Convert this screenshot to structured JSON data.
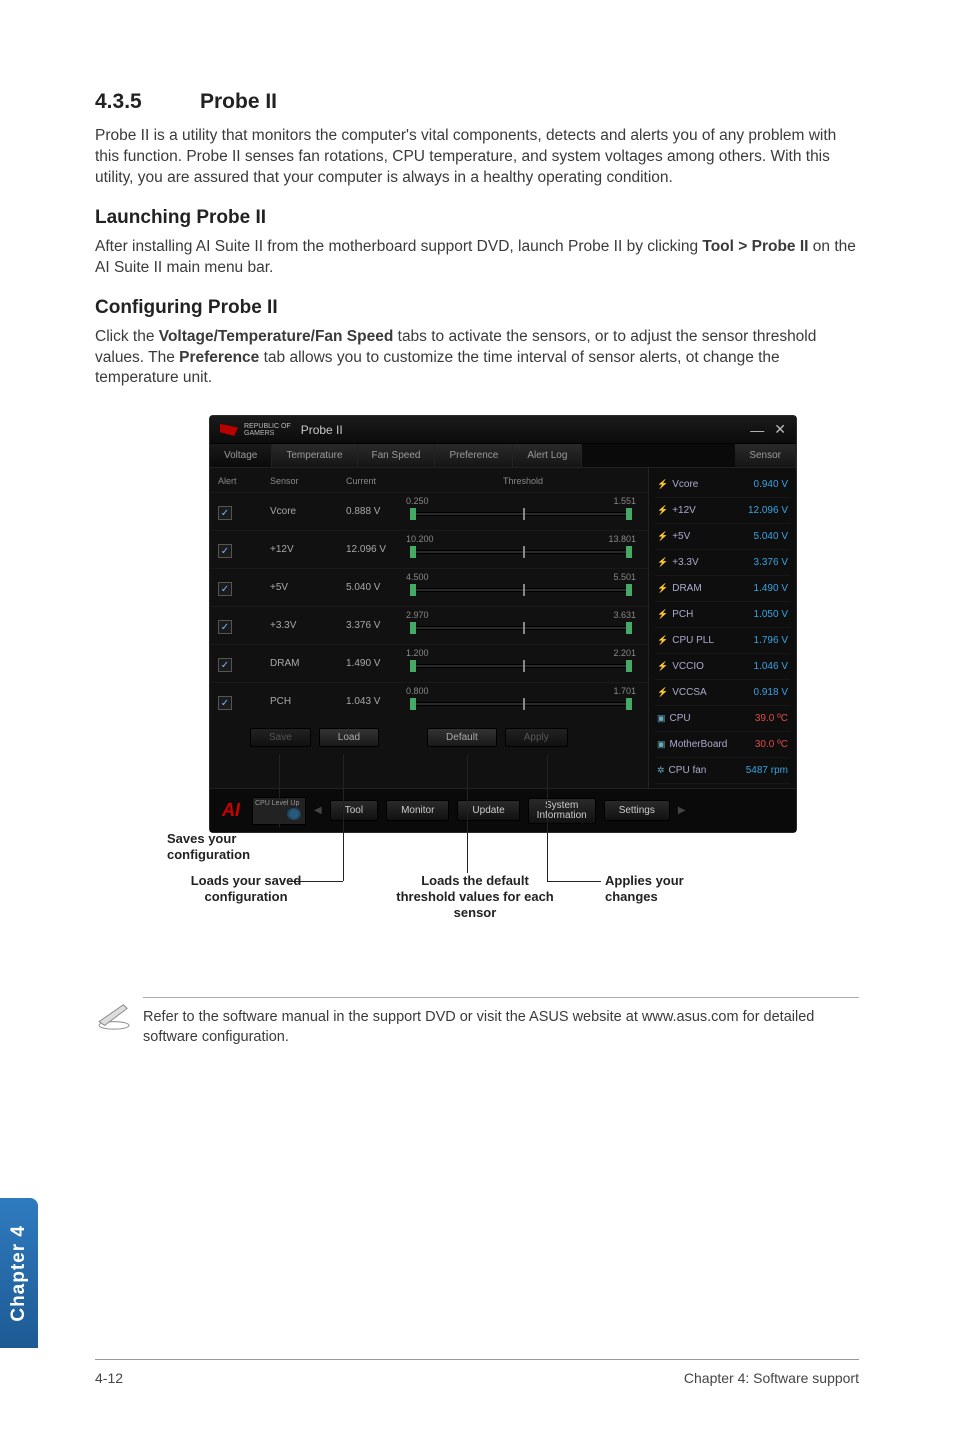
{
  "section": {
    "number": "4.3.5",
    "title": "Probe II"
  },
  "intro": "Probe II is a utility that monitors the computer's vital components, detects and alerts you of any problem with this function. Probe II senses fan rotations, CPU temperature, and system voltages among others. With this utility, you are assured that your computer is always in a healthy operating condition.",
  "launching": {
    "heading": "Launching Probe II",
    "text_before": "After installing AI Suite II from the motherboard support DVD, launch Probe II by clicking ",
    "bold": "Tool > Probe II",
    "text_after": " on the AI Suite II main menu bar."
  },
  "configuring": {
    "heading": "Configuring Probe II",
    "text_p1": "Click the ",
    "bold1": "Voltage/Temperature/Fan Speed",
    "text_p2": " tabs to activate the sensors, or to adjust the sensor threshold values. The ",
    "bold2": "Preference",
    "text_p3": " tab allows you to customize the time interval of sensor alerts, ot change the temperature unit."
  },
  "window": {
    "brand_line1": "REPUBLIC OF",
    "brand_line2": "GAMERS",
    "title": "Probe II",
    "tabs": {
      "voltage": "Voltage",
      "temperature": "Temperature",
      "fan": "Fan Speed",
      "preference": "Preference",
      "alertlog": "Alert Log",
      "sensor": "Sensor"
    },
    "headers": {
      "alert": "Alert",
      "sensor": "Sensor",
      "current": "Current",
      "threshold": "Threshold"
    },
    "rows": [
      {
        "name": "Vcore",
        "val": "0.888 V",
        "lo": "0.250",
        "hi": "1.551"
      },
      {
        "name": "+12V",
        "val": "12.096 V",
        "lo": "10.200",
        "hi": "13.801"
      },
      {
        "name": "+5V",
        "val": "5.040 V",
        "lo": "4.500",
        "hi": "5.501"
      },
      {
        "name": "+3.3V",
        "val": "3.376 V",
        "lo": "2.970",
        "hi": "3.631"
      },
      {
        "name": "DRAM",
        "val": "1.490 V",
        "lo": "1.200",
        "hi": "2.201"
      },
      {
        "name": "PCH",
        "val": "1.043 V",
        "lo": "0.800",
        "hi": "1.701"
      }
    ],
    "sensors": [
      {
        "icon": "bolt",
        "name": "Vcore",
        "val": "0.940 V"
      },
      {
        "icon": "bolt",
        "name": "+12V",
        "val": "12.096 V"
      },
      {
        "icon": "bolt",
        "name": "+5V",
        "val": "5.040 V"
      },
      {
        "icon": "bolt",
        "name": "+3.3V",
        "val": "3.376 V"
      },
      {
        "icon": "bolt",
        "name": "DRAM",
        "val": "1.490 V"
      },
      {
        "icon": "bolt",
        "name": "PCH",
        "val": "1.050 V"
      },
      {
        "icon": "bolt",
        "name": "CPU PLL",
        "val": "1.796 V"
      },
      {
        "icon": "bolt",
        "name": "VCCIO",
        "val": "1.046 V"
      },
      {
        "icon": "bolt",
        "name": "VCCSA",
        "val": "0.918 V"
      },
      {
        "icon": "chip",
        "name": "CPU",
        "val": "39.0 ºC"
      },
      {
        "icon": "chip",
        "name": "MotherBoard",
        "val": "30.0 ºC"
      },
      {
        "icon": "fan",
        "name": "CPU fan",
        "val": "5487 rpm"
      }
    ],
    "buttons": {
      "save": "Save",
      "load": "Load",
      "default": "Default",
      "apply": "Apply"
    },
    "bottom": {
      "cpu_level": "CPU Level\nUp",
      "tool": "Tool",
      "monitor": "Monitor",
      "update": "Update",
      "sysinfo": "System\nInformation",
      "settings": "Settings"
    }
  },
  "callouts": {
    "saves": "Saves your configuration",
    "loads_saved": "Loads your saved configuration",
    "loads_default": "Loads the default threshold values for each sensor",
    "applies": "Applies your changes"
  },
  "note": "Refer to the software manual in the support DVD or visit the ASUS website at www.asus.com for detailed software configuration.",
  "sidetab": "Chapter 4",
  "footer": {
    "left": "4-12",
    "right": "Chapter 4: Software support"
  }
}
